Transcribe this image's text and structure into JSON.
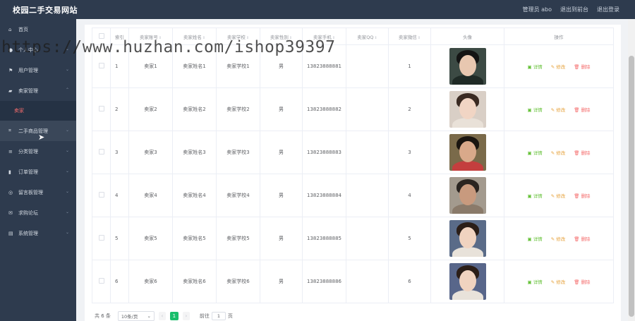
{
  "header": {
    "title": "校园二手交易网站",
    "admin_label": "管理员 abo",
    "exit_front_label": "退出到前台",
    "logout_label": "退出登录"
  },
  "sidebar": {
    "items": [
      {
        "label": "首页",
        "icon": "home-icon",
        "has_children": false
      },
      {
        "label": "个人中心",
        "icon": "user-icon",
        "has_children": true
      },
      {
        "label": "用户管理",
        "icon": "flag-icon",
        "has_children": true
      },
      {
        "label": "卖家管理",
        "icon": "chat-icon",
        "has_children": true,
        "expanded": true
      },
      {
        "label": "二手商品管理",
        "icon": "crop-icon",
        "has_children": true
      },
      {
        "label": "分类管理",
        "icon": "sliders-icon",
        "has_children": true
      },
      {
        "label": "订单管理",
        "icon": "chart-icon",
        "has_children": true
      },
      {
        "label": "留言板管理",
        "icon": "message-icon",
        "has_children": true
      },
      {
        "label": "求购论坛",
        "icon": "mail-icon",
        "has_children": true
      },
      {
        "label": "系统管理",
        "icon": "server-icon",
        "has_children": true
      }
    ],
    "submenu_active": "卖家"
  },
  "table": {
    "headers": [
      "索引",
      "卖家账号",
      "卖家姓名",
      "卖家学校",
      "卖家性别",
      "卖家手机",
      "卖家QQ",
      "卖家微信",
      "头像",
      "操作"
    ],
    "rows": [
      {
        "index": "1",
        "account": "卖家1",
        "name": "卖家姓名1",
        "school": "卖家学校1",
        "gender": "男",
        "phone": "13823888881",
        "qq": "",
        "wechat": "1"
      },
      {
        "index": "2",
        "account": "卖家2",
        "name": "卖家姓名2",
        "school": "卖家学校2",
        "gender": "男",
        "phone": "13823888882",
        "qq": "",
        "wechat": "2"
      },
      {
        "index": "3",
        "account": "卖家3",
        "name": "卖家姓名3",
        "school": "卖家学校3",
        "gender": "男",
        "phone": "13823888883",
        "qq": "",
        "wechat": "3"
      },
      {
        "index": "4",
        "account": "卖家4",
        "name": "卖家姓名4",
        "school": "卖家学校4",
        "gender": "男",
        "phone": "13823888884",
        "qq": "",
        "wechat": "4"
      },
      {
        "index": "5",
        "account": "卖家5",
        "name": "卖家姓名5",
        "school": "卖家学校5",
        "gender": "男",
        "phone": "13823888885",
        "qq": "",
        "wechat": "5"
      },
      {
        "index": "6",
        "account": "卖家6",
        "name": "卖家姓名6",
        "school": "卖家学校6",
        "gender": "男",
        "phone": "13823888886",
        "qq": "",
        "wechat": "6"
      }
    ],
    "actions": {
      "detail": "详情",
      "edit": "修改",
      "delete": "删除"
    }
  },
  "pagination": {
    "total": "共 6 条",
    "page_size": "10条/页",
    "current_page": "1",
    "goto_label": "前往",
    "goto_value": "1",
    "page_unit": "页"
  },
  "watermark": "https://www.huzhan.com/ishop39397",
  "colors": {
    "sidebar_bg": "#2e3b4e",
    "detail": "#67c23a",
    "edit": "#e6a23c",
    "delete": "#f56c6c",
    "active_page": "#19be6b"
  }
}
